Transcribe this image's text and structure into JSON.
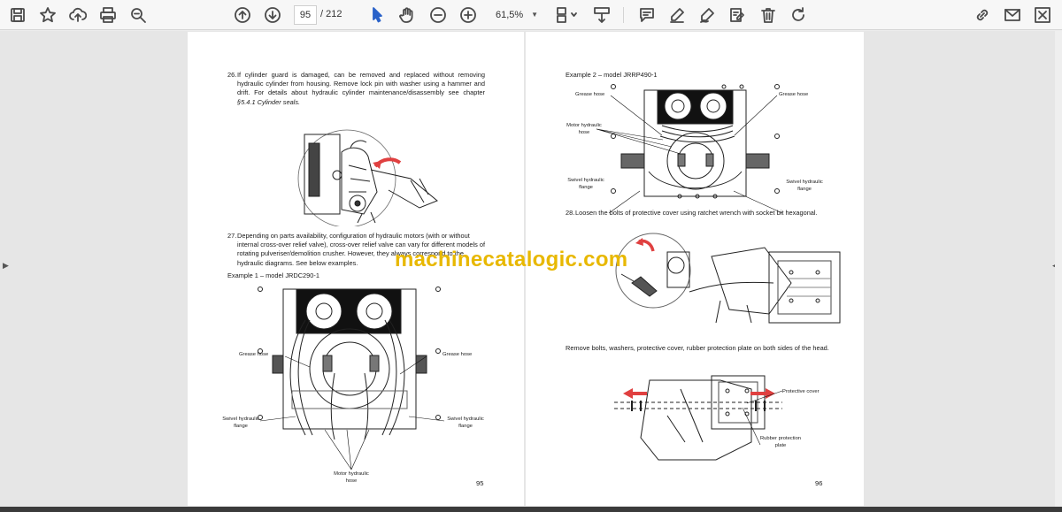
{
  "toolbar": {
    "current_page": "95",
    "total_pages": "/ 212",
    "zoom": "61,5%"
  },
  "left_page": {
    "step26_num": "26.",
    "step26_text": "If cylinder guard is damaged, can be removed and replaced without removing hydraulic cylinder from housing. Remove lock pin with washer using a hammer and drift. For details about hydraulic cylinder maintenance/disassembly see chapter ",
    "step26_ref": "§5.4.1 Cylinder seals.",
    "step27_num": "27.",
    "step27_text": "Depending on parts availability, configuration of hydraulic motors (with or without internal cross-over relief valve), cross-over relief valve can vary for different models of rotating pulveriser/demolition crusher. However, they always correspond to the hydraulic diagrams. See below examples.",
    "example1": "Example 1 – model JRDC290-1",
    "labels": {
      "grease_hose_left": "Grease hose",
      "grease_hose_right": "Grease hose",
      "swivel_left": "Swivel hydraulic flange",
      "swivel_right": "Swivel hydraulic flange",
      "motor_hose": "Motor hydraulic hose"
    },
    "page_number": "95"
  },
  "right_page": {
    "example2": "Example 2 – model JRRP490-1",
    "labels": {
      "grease_hose_left": "Grease hose",
      "grease_hose_right": "Grease hose",
      "motor_hose": "Motor hydraulic hose",
      "swivel_left": "Swivel hydraulic flange",
      "swivel_right": "Swivel hydraulic flange",
      "protective_cover": "Protective cover",
      "rubber_plate": "Rubber protection plate"
    },
    "step28_num": "28.",
    "step28_text": "Loosen the bolts of protective cover using ratchet wrench with socket bit hexagonal.",
    "remove_text": "Remove bolts, washers, protective cover, rubber protection plate on both sides of the head.",
    "page_number": "96"
  },
  "watermark": "machinecatalogic.com",
  "colors": {
    "accent_blue": "#2a62c9",
    "watermark": "#e8b800",
    "arrow_red": "#e04040"
  }
}
